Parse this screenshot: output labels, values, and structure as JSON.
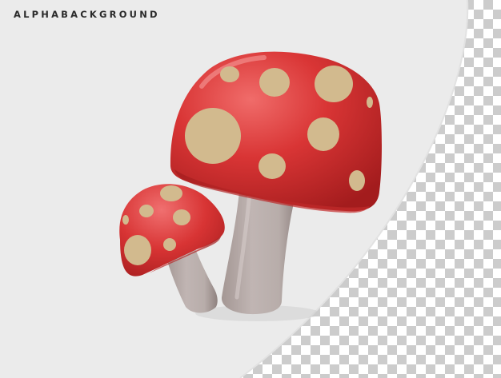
{
  "watermark": {
    "text": "ALPHABACKGROUND"
  },
  "colors": {
    "backdrop": "#ebebeb",
    "checker_light": "#ffffff",
    "checker_dark": "#cccccc",
    "cap_red": "#d63a3a",
    "cap_red_dark": "#a81f20",
    "spots": "#d2ba8e",
    "stem": "#b0a4a2"
  },
  "subject": {
    "object_icon": "mushroom-icon",
    "count": 2
  }
}
